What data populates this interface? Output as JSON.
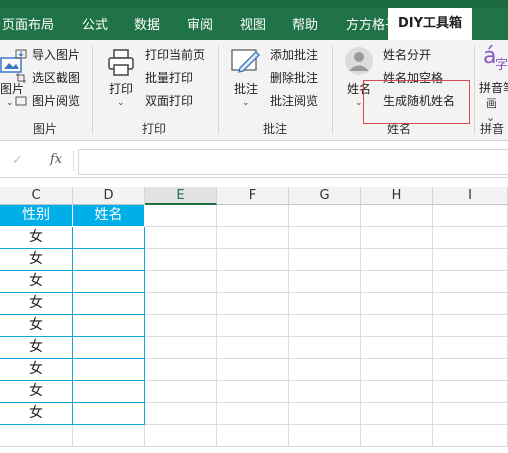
{
  "tabs": [
    "页面布局",
    "公式",
    "数据",
    "审阅",
    "视图",
    "帮助",
    "方方格子",
    "DIY工具箱"
  ],
  "active_tab": "DIY工具箱",
  "ribbon": {
    "picture_group": {
      "big_label": "图片",
      "items": [
        "导入图片",
        "选区截图",
        "图片阅览"
      ],
      "label": "图片"
    },
    "print_group": {
      "big_label": "打印",
      "items": [
        "打印当前页",
        "批量打印",
        "双面打印"
      ],
      "label": "打印"
    },
    "comment_group": {
      "big_label": "批注",
      "items": [
        "添加批注",
        "删除批注",
        "批注阅览"
      ],
      "label": "批注"
    },
    "name_group": {
      "big_label": "姓名",
      "items": [
        "姓名分开",
        "姓名加空格",
        "生成随机姓名"
      ],
      "label": "姓名"
    },
    "pinyin_group": {
      "icon_char": "字",
      "big_label": "拼音笔画",
      "label": "拼音"
    }
  },
  "formula_bar": {
    "cancel": "✓",
    "fx": "fx",
    "value": ""
  },
  "columns": [
    "C",
    "D",
    "E",
    "F",
    "G",
    "H",
    "I"
  ],
  "selected_column": "E",
  "table": {
    "headers": [
      "性别",
      "姓名"
    ],
    "rows": [
      "女",
      "女",
      "女",
      "女",
      "女",
      "女",
      "女",
      "女",
      "女"
    ]
  },
  "colors": {
    "ribbon_green": "#1f7346",
    "header_fill": "#00aee8",
    "highlight_box": "#d94848"
  }
}
